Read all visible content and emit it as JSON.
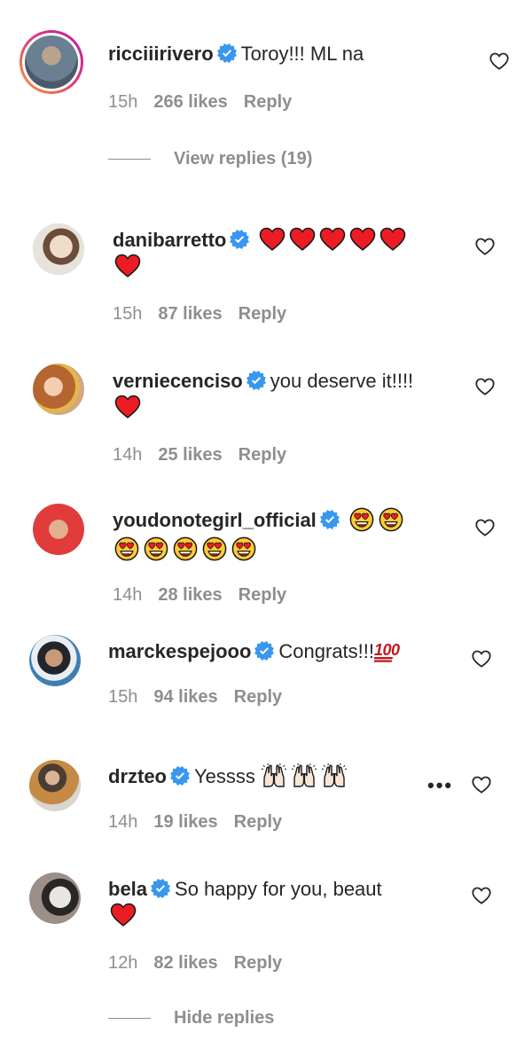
{
  "comments": [
    {
      "username": "ricciiirivero",
      "text": "Toroy!!! ML na",
      "time": "15h",
      "likes": "266 likes",
      "reply": "Reply",
      "avatar_color": "#7a8a9a"
    },
    {
      "username": "danibarretto",
      "text": "",
      "time": "15h",
      "likes": "87 likes",
      "reply": "Reply",
      "avatar_color": "#d8c3b0"
    },
    {
      "username": "verniecenciso",
      "text": "you deserve it!!!!",
      "time": "14h",
      "likes": "25 likes",
      "reply": "Reply",
      "avatar_color": "#c98a5a"
    },
    {
      "username": "youdonotegirl_official",
      "text": "",
      "time": "14h",
      "likes": "28 likes",
      "reply": "Reply",
      "avatar_color": "#e23b3b"
    },
    {
      "username": "marckespejooo",
      "text": "Congrats!!!",
      "time": "15h",
      "likes": "94 likes",
      "reply": "Reply",
      "avatar_color": "#4a5560"
    },
    {
      "username": "drzteo",
      "text": "Yessss",
      "time": "14h",
      "likes": "19 likes",
      "reply": "Reply",
      "avatar_color": "#8a7a62"
    },
    {
      "username": "bela",
      "text": "So happy for you, beaut",
      "time": "12h",
      "likes": "82 likes",
      "reply": "Reply",
      "avatar_color": "#3a3535"
    }
  ],
  "view_replies": "View replies (19)",
  "hide_replies": "Hide replies",
  "more_dots": "•••",
  "colors": {
    "text": "#262626",
    "meta": "#8e8e8e",
    "verified": "#3897f0",
    "heart_red": "#ed1c24"
  },
  "icons": {
    "verified": "verified-badge-icon",
    "like": "heart-outline-icon",
    "red_heart": "red-heart-emoji",
    "heart_eyes": "heart-eyes-emoji",
    "raising_hands": "raising-hands-emoji",
    "hundred": "hundred-points-emoji"
  }
}
